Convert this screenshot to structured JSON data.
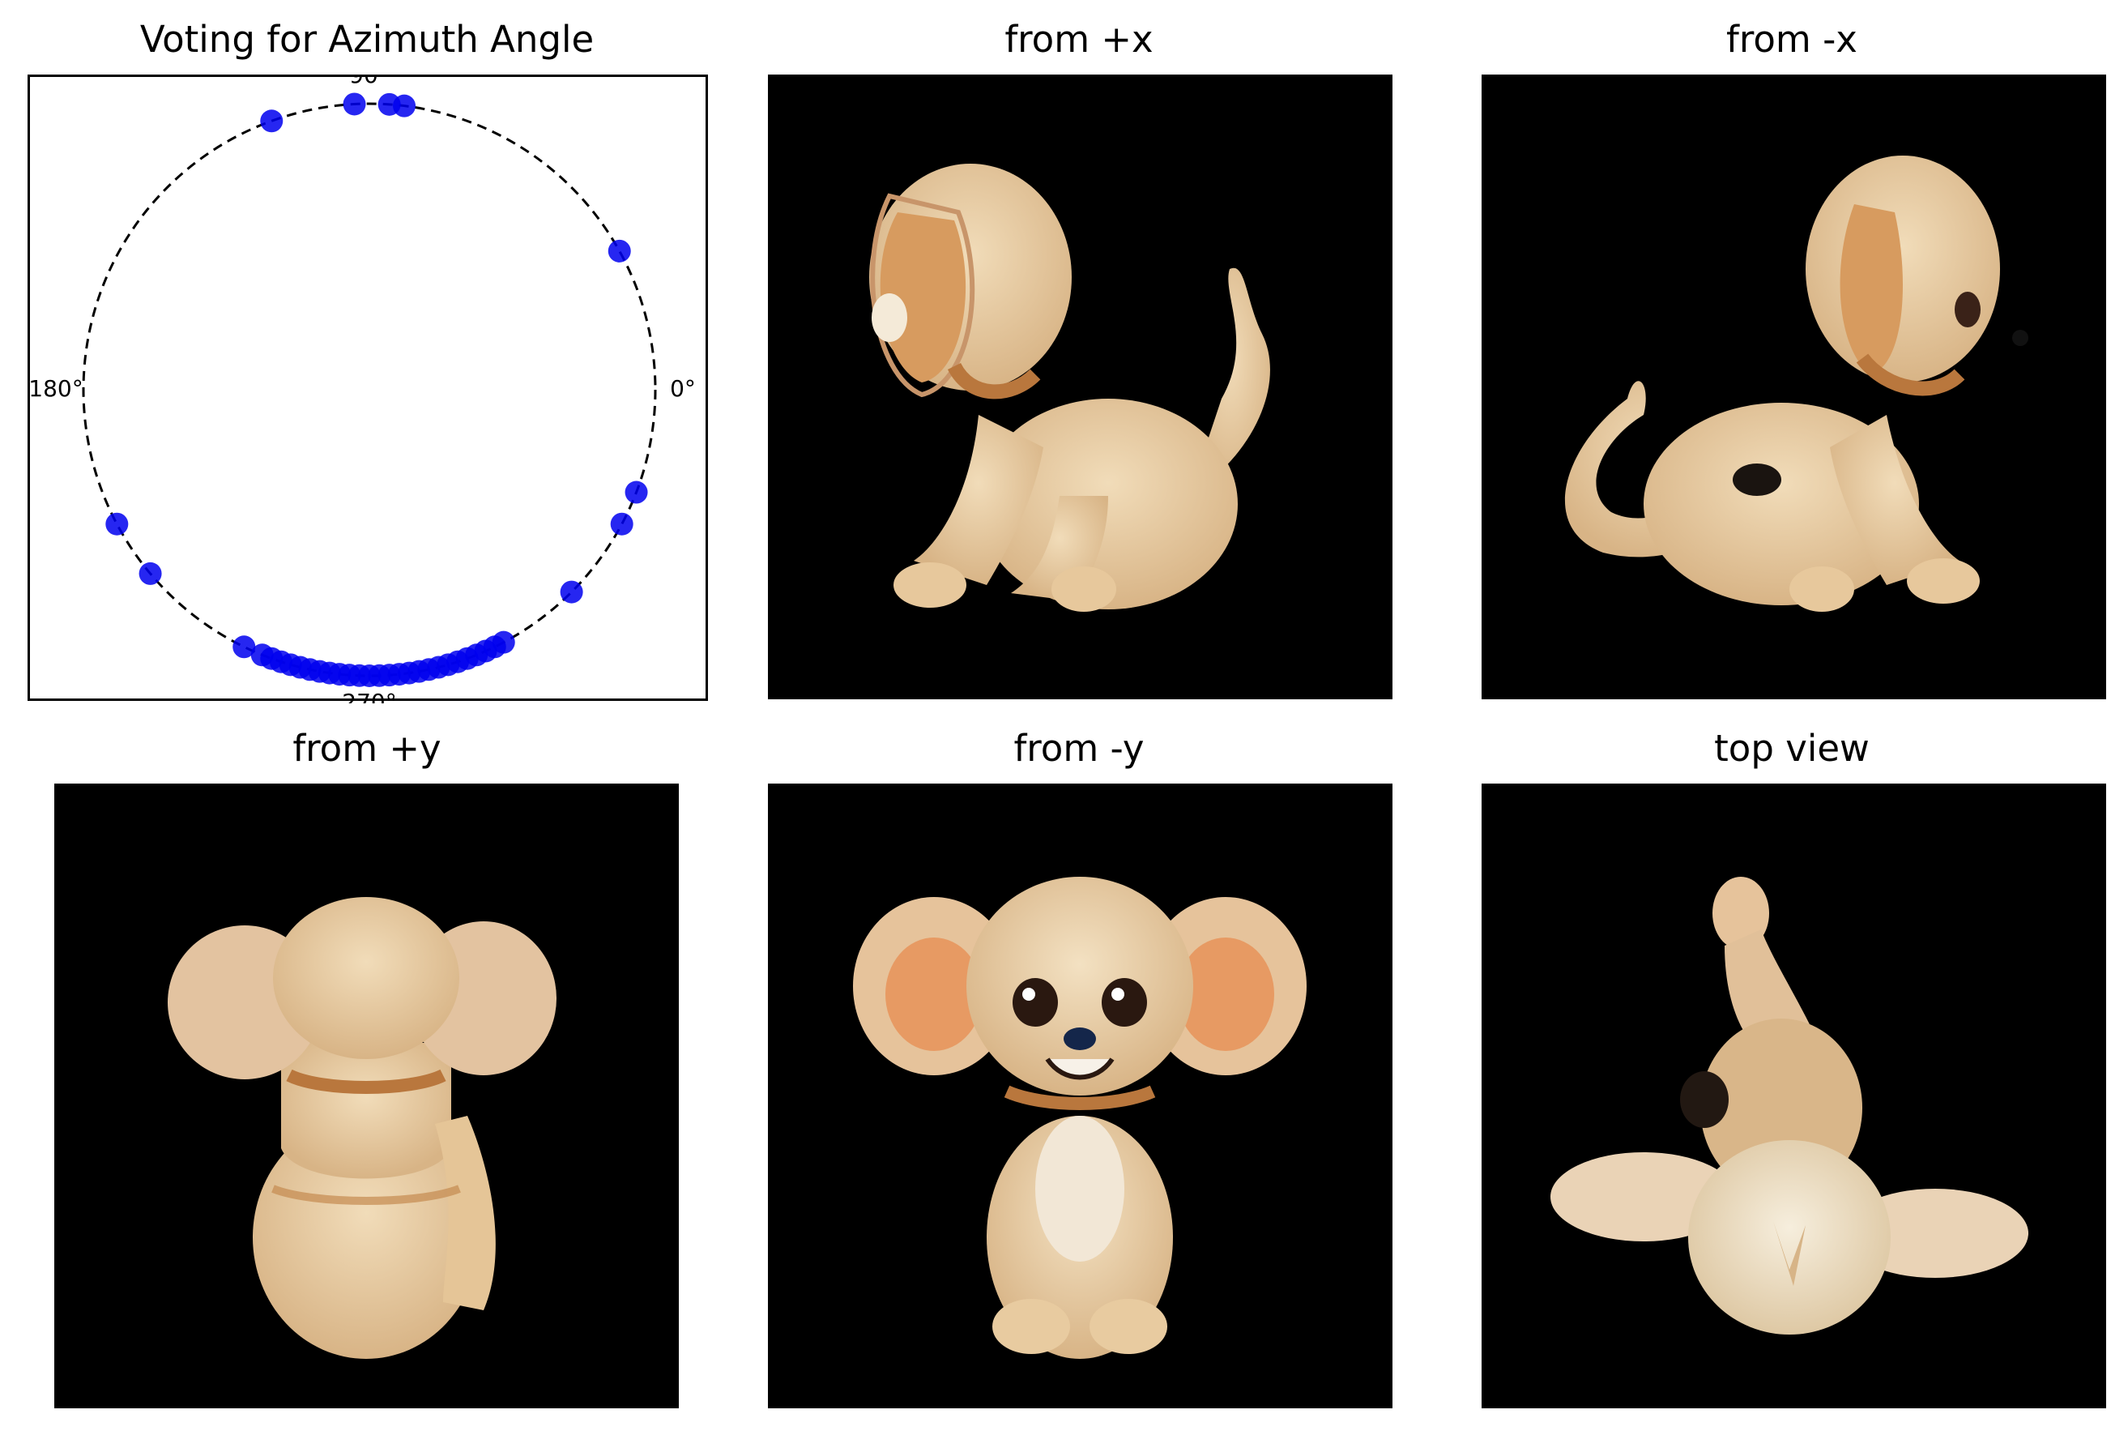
{
  "chart_data": {
    "type": "scatter",
    "projection": "polar",
    "title": "Voting for Azimuth Angle",
    "angle_unit": "degrees",
    "angle_tick_labels": [
      {
        "angle": 0,
        "label": "0°"
      },
      {
        "angle": 90,
        "label": "90°"
      },
      {
        "angle": 180,
        "label": "180°"
      },
      {
        "angle": 270,
        "label": "270°"
      }
    ],
    "reference_circle": {
      "radius": 1.0,
      "style": "dashed",
      "color": "#000000"
    },
    "series": [
      {
        "marker_color": "#0000ee",
        "points_angle_deg": [
          110,
          93,
          86,
          83,
          29,
          339,
          332,
          315,
          208,
          220,
          244,
          248,
          250,
          252,
          254,
          256,
          258,
          260,
          262,
          264,
          266,
          268,
          270,
          272,
          274,
          276,
          278,
          280,
          282,
          284,
          286,
          288,
          290,
          292,
          294,
          296,
          298
        ],
        "radius": 1.0
      }
    ],
    "grid": false,
    "legend": "none"
  },
  "panels": [
    {
      "title": "from +x",
      "view": "side-facing-left"
    },
    {
      "title": "from -x",
      "view": "side-facing-right"
    },
    {
      "title": "from +y",
      "view": "back"
    },
    {
      "title": "from -y",
      "view": "front"
    },
    {
      "title": "top view",
      "view": "top"
    }
  ],
  "colors": {
    "background_images": "#000000",
    "figurine": "#e9cda3",
    "figurine_shadow": "#c79a68",
    "fur_accent": "#b9773d",
    "marker": "#0000ee"
  }
}
